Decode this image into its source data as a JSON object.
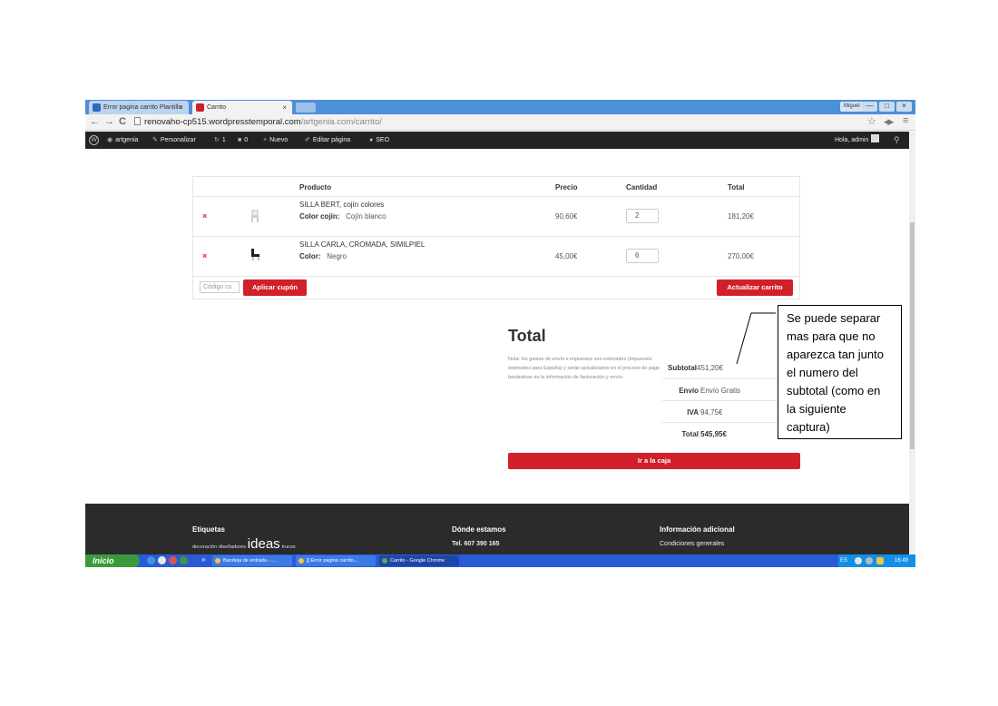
{
  "browser": {
    "tabs": [
      {
        "label": "Error pagina carrito Plantillo",
        "close": "×"
      },
      {
        "label": "Carrito",
        "close": "×"
      }
    ],
    "window_user": "Miguel",
    "window_controls": [
      "—",
      "□",
      "×"
    ],
    "url_host": "renovaho-cp515.wordpresstemporal.com",
    "url_path": "/artgenia.com/carrito/",
    "nav": {
      "back": "←",
      "forward": "→",
      "reload": "C"
    },
    "star": "☆",
    "menu": "≡"
  },
  "admin_bar": {
    "site": "artgenia",
    "customize": "Personalizar",
    "updates": "1",
    "comments": "0",
    "new": "Nuevo",
    "edit": "Editar página",
    "seo": "SEO",
    "greeting": "Hola, admin"
  },
  "cart": {
    "headers": {
      "product": "Producto",
      "price": "Precio",
      "quantity": "Cantidad",
      "total": "Total"
    },
    "items": [
      {
        "remove": "×",
        "name": "SILLA BERT, cojín colores",
        "variation_label": "Color cojín:",
        "variation_value": "Cojín blanco",
        "price": "90,60€",
        "quantity": "2",
        "total": "181,20€"
      },
      {
        "remove": "×",
        "name": "SILLA CARLA, CROMADA, SIMILPIEL",
        "variation_label": "Color:",
        "variation_value": "Negro",
        "price": "45,00€",
        "quantity": "6",
        "total": "270,00€"
      }
    ],
    "coupon_placeholder": "Código cu",
    "apply_coupon": "Aplicar cupón",
    "update_cart": "Actualizar carrito"
  },
  "totals": {
    "title": "Total",
    "note": "Nota: los gastos de envío e impuestos son estimados (impuestos estimados para España) y serán actualizados en el proceso de pago basándose en la información de facturación y envío.",
    "subtotal_label": "Subtotal",
    "subtotal_value": "451,20€",
    "shipping_label": "Envío",
    "shipping_value": "Envío Gratis",
    "iva_label": "IVA",
    "iva_value": "94,75€",
    "total_label": "Total",
    "total_value": "545,95€",
    "checkout": "Ir a la caja"
  },
  "footer": {
    "col1_title": "Etiquetas",
    "tags": [
      "decoración",
      "diseñadores",
      "ideas",
      "trucos"
    ],
    "col2_title": "Dónde estamos",
    "phone": "Tel. 607 390 165",
    "col3_title": "Información adicional",
    "conditions": "Condiciones generales"
  },
  "taskbar": {
    "start": "Inicio",
    "overflow": "»",
    "tasks": [
      "Bandeja de entrada - ...",
      "[] Error pagina carrito...",
      "Carrito - Google Chrome"
    ],
    "lang": "ES",
    "clock": "16:49"
  },
  "annotation": {
    "text": "Se puede separar\nmas para que no\naparezca tan junto\nel numero del\nsubtotal (como en\nla siguiente\ncaptura)"
  }
}
